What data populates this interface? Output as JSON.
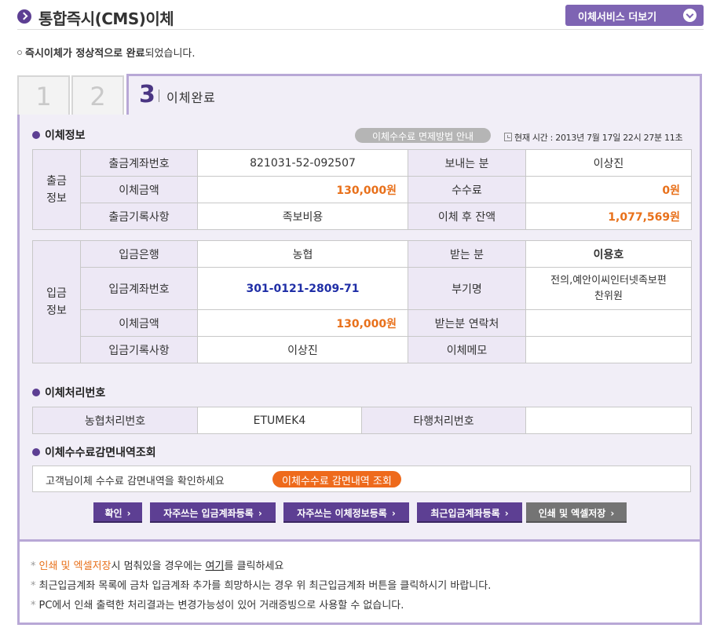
{
  "header": {
    "title": "통합즉시(CMS)이체",
    "more_button": "이체서비스 더보기"
  },
  "notice": {
    "bold_part": "즉시이체가 정상적으로 완료",
    "rest": "되었습니다."
  },
  "steps": {
    "step1": "1",
    "step2": "2",
    "step3_num": "3",
    "step3_label": "이체완료"
  },
  "transfer_info": {
    "section_title": "이체정보",
    "fee_button": "이체수수료 면제방법 안내",
    "time": "현재 시간 : 2013년 7월 17일  22시 27분 11초",
    "out": {
      "side_label": "출금\n정보",
      "rows": [
        {
          "l1": "출금계좌번호",
          "v1": "821031-52-092507",
          "l2": "보내는 분",
          "v2": "이상진"
        },
        {
          "l1": "이체금액",
          "v1": "130,000원",
          "l2": "수수료",
          "v2": "0원"
        },
        {
          "l1": "출금기록사항",
          "v1": "족보비용",
          "l2": "이체 후 잔액",
          "v2": "1,077,569원"
        }
      ]
    },
    "in": {
      "side_label": "입금\n정보",
      "rows": [
        {
          "l1": "입금은행",
          "v1": "농협",
          "l2": "받는 분",
          "v2": "이용호"
        },
        {
          "l1": "입금계좌번호",
          "v1": "301-0121-2809-71",
          "l2": "부기명",
          "v2": "전의,예안이씨인터넷족보편찬위원"
        },
        {
          "l1": "이체금액",
          "v1": "130,000원",
          "l2": "받는분 연락처",
          "v2": ""
        },
        {
          "l1": "입금기록사항",
          "v1": "이상진",
          "l2": "이체메모",
          "v2": ""
        }
      ]
    }
  },
  "processing": {
    "section_title": "이체처리번호",
    "nh_label": "농협처리번호",
    "nh_value": "ETUMEK4",
    "other_label": "타행처리번호",
    "other_value": ""
  },
  "fee_lookup": {
    "section_title": "이체수수료감면내역조회",
    "text": "고객님이체 수수료 감면내역을 확인하세요",
    "button": "이체수수료 감면내역 조회"
  },
  "buttons": {
    "confirm": "확인",
    "fav_account": "자주쓰는 입금계좌등록",
    "fav_info": "자주쓰는 이체정보등록",
    "recent_account": "최근입금계좌등록",
    "print_excel": "인쇄 및 엑셀저장"
  },
  "notes": {
    "n1_orange": "인쇄 및 엑셀저장",
    "n1_mid": "시 멈춰있을 경우에는 ",
    "n1_link": "여기",
    "n1_end": "를 클릭하세요",
    "n2": "최근입금계좌 목록에 금차 입금계좌 추가를 희망하시는 경우 위 최근입금계좌 버튼을 클릭하시기 바랍니다.",
    "n3": "PC에서 인쇄 출력한 처리결과는 변경가능성이 있어 거래증빙으로 사용할 수 없습니다."
  },
  "colors": {
    "brand": "#5d3f93",
    "panel_bg": "#f1eef7",
    "amount": "#e8701a",
    "account": "#1f2ea6"
  }
}
